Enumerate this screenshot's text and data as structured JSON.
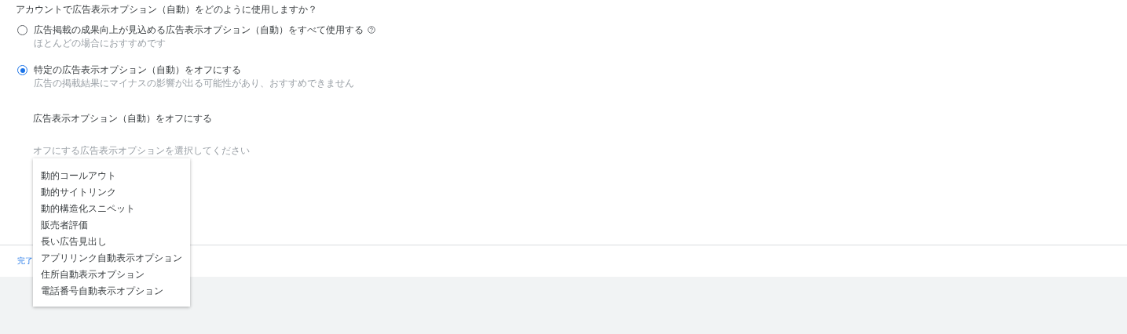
{
  "question": "アカウントで広告表示オプション（自動）をどのように使用しますか？",
  "options": [
    {
      "label": "広告掲載の成果向上が見込める広告表示オプション（自動）をすべて使用する",
      "help_icon": true,
      "hint": "ほとんどの場合におすすめです",
      "selected": false
    },
    {
      "label": "特定の広告表示オプション（自動）をオフにする",
      "help_icon": false,
      "hint": "広告の掲載結果にマイナスの影響が出る可能性があり、おすすめできません",
      "selected": true
    }
  ],
  "turn_off": {
    "heading": "広告表示オプション（自動）をオフにする",
    "select": {
      "placeholder": "オフにする広告表示オプションを選択してください"
    }
  },
  "menu": {
    "items": [
      "動的コールアウト",
      "動的サイトリンク",
      "動的構造化スニペット",
      "販売者評価",
      "長い広告見出し",
      "アプリリンク自動表示オプション",
      "住所自動表示オプション",
      "電話番号自動表示オプション"
    ]
  },
  "done_button": "完了"
}
